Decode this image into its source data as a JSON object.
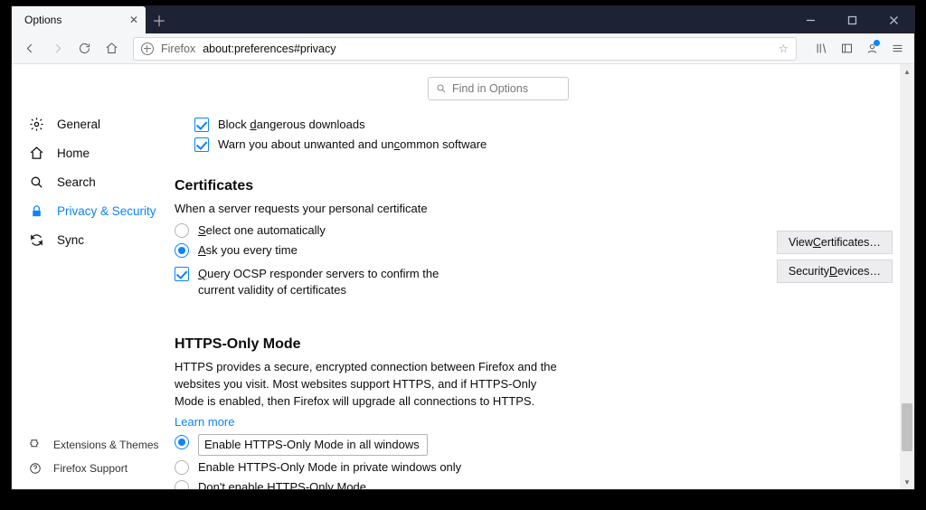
{
  "tab": {
    "title": "Options"
  },
  "urlbar": {
    "identity": "Firefox",
    "url": "about:preferences#privacy"
  },
  "search_in_options_placeholder": "Find in Options",
  "sidebar": {
    "items": [
      {
        "label": "General"
      },
      {
        "label": "Home"
      },
      {
        "label": "Search"
      },
      {
        "label": "Privacy & Security"
      },
      {
        "label": "Sync"
      }
    ],
    "bottom": [
      {
        "label": "Extensions & Themes"
      },
      {
        "label": "Firefox Support"
      }
    ]
  },
  "downloads": {
    "block_dangerous": "Block dangerous downloads",
    "warn_uncommon": "Warn you about unwanted and uncommon software"
  },
  "certificates": {
    "heading": "Certificates",
    "desc": "When a server requests your personal certificate",
    "select_auto": "Select one automatically",
    "ask_every": "Ask you every time",
    "ocsp": "Query OCSP responder servers to confirm the current validity of certificates",
    "view_btn": "View Certificates…",
    "devices_btn": "Security Devices…"
  },
  "https": {
    "heading": "HTTPS-Only Mode",
    "desc": "HTTPS provides a secure, encrypted connection between Firefox and the websites you visit. Most websites support HTTPS, and if HTTPS-Only Mode is enabled, then Firefox will upgrade all connections to HTTPS.",
    "learn_more": "Learn more",
    "opt_all": "Enable HTTPS-Only Mode in all windows",
    "opt_private": "Enable HTTPS-Only Mode in private windows only",
    "opt_off": "Don't enable HTTPS-Only Mode"
  }
}
